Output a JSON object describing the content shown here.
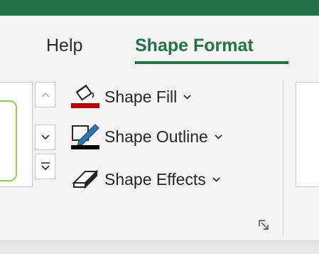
{
  "tabs": [
    {
      "label": "Help",
      "active": false
    },
    {
      "label": "Shape Format",
      "active": true
    }
  ],
  "commands": [
    {
      "label": "Shape Fill",
      "icon": "paint-bucket-icon",
      "color_bar": "#c00000"
    },
    {
      "label": "Shape Outline",
      "icon": "pen-icon",
      "color_bar": "#000000"
    },
    {
      "label": "Shape Effects",
      "icon": "eraser-effects-icon"
    }
  ],
  "gallery": {
    "scroll_up_icon": "chevron-up-icon",
    "scroll_down_icon": "chevron-down-icon",
    "more_icon": "gallery-more-icon",
    "style_outline_color": "#92d050"
  },
  "group_launcher_icon": "dialog-launcher-icon",
  "colors": {
    "accent": "#217346",
    "ribbon_background": "#f3f3f3"
  }
}
